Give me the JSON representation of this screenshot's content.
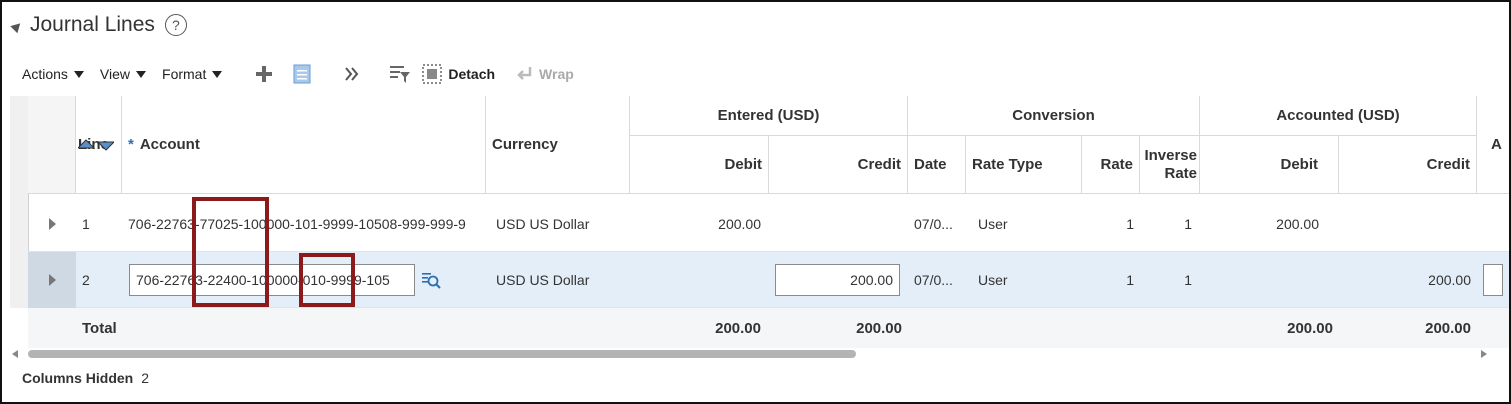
{
  "section": {
    "title": "Journal Lines",
    "help": "?"
  },
  "toolbar": {
    "actions": "Actions",
    "view": "View",
    "format": "Format",
    "detach": "Detach",
    "wrap": "Wrap"
  },
  "columns": {
    "line": "Line",
    "account_req": "*",
    "account": "Account",
    "currency": "Currency",
    "entered_group": "Entered (USD)",
    "entered_debit": "Debit",
    "entered_credit": "Credit",
    "conversion_group": "Conversion",
    "conv_date": "Date",
    "conv_rate_type": "Rate Type",
    "conv_rate": "Rate",
    "conv_inverse_rate": "Inverse Rate",
    "accounted_group": "Accounted (USD)",
    "acc_debit": "Debit",
    "acc_credit": "Credit",
    "extra": "A"
  },
  "rows": [
    {
      "line": "1",
      "account": "706-22763-77025-100000-101-9999-10508-999-999-9",
      "currency": "USD US Dollar",
      "entered_debit": "200.00",
      "entered_credit": "",
      "date": "07/0...",
      "rate_type": "User",
      "rate": "1",
      "inverse_rate": "1",
      "acc_debit": "200.00",
      "acc_credit": ""
    },
    {
      "line": "2",
      "account": "706-22763-22400-100000-010-9999-105",
      "currency": "USD US Dollar",
      "entered_debit": "",
      "entered_credit": "200.00",
      "date": "07/0...",
      "rate_type": "User",
      "rate": "1",
      "inverse_rate": "1",
      "acc_debit": "",
      "acc_credit": "200.00"
    }
  ],
  "totals": {
    "label": "Total",
    "entered_debit": "200.00",
    "entered_credit": "200.00",
    "acc_debit": "200.00",
    "acc_credit": "200.00"
  },
  "footer": {
    "label": "Columns Hidden",
    "count": "2"
  },
  "colors": {
    "highlight": "#8b1a1a",
    "selected_row": "#e3eef9",
    "accent": "#2a6ebb"
  }
}
